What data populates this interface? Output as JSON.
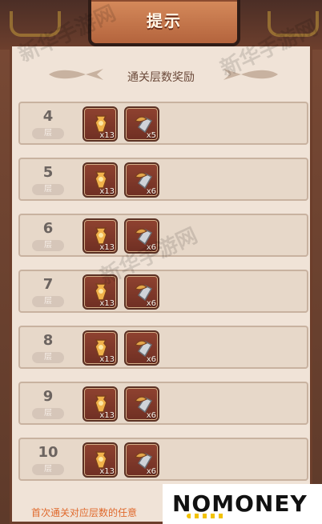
{
  "dialog": {
    "title": "提示",
    "subtitle": "通关层数奖励",
    "footer_text": "首次通关对应层数的任意"
  },
  "rows": [
    {
      "level": "4",
      "floor_label": "层",
      "item1_count": "x13",
      "item2_count": "x5"
    },
    {
      "level": "5",
      "floor_label": "层",
      "item1_count": "x13",
      "item2_count": "x6"
    },
    {
      "level": "6",
      "floor_label": "层",
      "item1_count": "x13",
      "item2_count": "x6"
    },
    {
      "level": "7",
      "floor_label": "层",
      "item1_count": "x13",
      "item2_count": "x6"
    },
    {
      "level": "8",
      "floor_label": "层",
      "item1_count": "x13",
      "item2_count": "x6"
    },
    {
      "level": "9",
      "floor_label": "层",
      "item1_count": "x13",
      "item2_count": "x6"
    },
    {
      "level": "10",
      "floor_label": "层",
      "item1_count": "x13",
      "item2_count": "x6"
    }
  ],
  "icons": {
    "item1": "golden-bottle-icon",
    "item2": "steel-sword-shard-icon",
    "fish": "fish-ornament-icon"
  },
  "branding": {
    "logo_text": "NOMONEY"
  },
  "watermarks": [
    "新华手游网",
    "新华手游网",
    "新华手游网"
  ]
}
